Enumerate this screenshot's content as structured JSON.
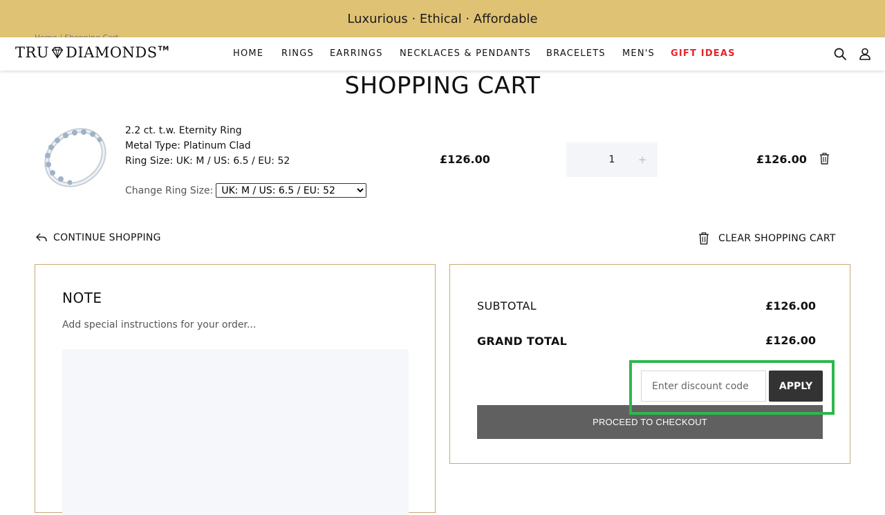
{
  "promo": {
    "text": "Luxurious · Ethical · Affordable"
  },
  "breadcrumb_ghost": "Home / Shopping Cart",
  "header": {
    "logo_left": "TRU",
    "logo_right": "DIAMONDS",
    "logo_tm": "TM",
    "nav": [
      "HOME",
      "RINGS",
      "EARRINGS",
      "NECKLACES & PENDANTS",
      "BRACELETS",
      "MEN'S",
      "GIFT IDEAS"
    ],
    "nav_accent_index": 6,
    "icons": [
      "search-icon",
      "user-icon"
    ]
  },
  "page_title": "SHOPPING CART",
  "cart_item": {
    "image_icon": "eternity-ring-image",
    "name": "2.2 ct. t.w. Eternity Ring",
    "metal": "Metal Type: Platinum Clad",
    "ring_size": "Ring Size: UK: M / US: 6.5 / EU: 52",
    "change_size_label": "Change Ring Size:",
    "change_size_selected": "UK: M / US: 6.5 / EU: 52",
    "unit_price": "£126.00",
    "quantity": "1",
    "plus": "+",
    "line_total": "£126.00",
    "remove_icon": "trash-icon"
  },
  "actions": {
    "continue_shopping": "CONTINUE SHOPPING",
    "clear_cart": "CLEAR SHOPPING CART"
  },
  "note": {
    "title": "NOTE",
    "hint": "Add special instructions for your order..."
  },
  "summary": {
    "subtotal_label": "SUBTOTAL",
    "subtotal_value": "£126.00",
    "grand_total_label": "GRAND TOTAL",
    "grand_total_value": "£126.00",
    "discount_placeholder": "Enter discount code",
    "apply_label": "APPLY",
    "checkout_label": "PROCEED TO CHECKOUT"
  },
  "colors": {
    "promo_bg": "#e0c274",
    "accent_red": "#e8232a",
    "box_border": "#c8a874",
    "highlight_green": "#2db84d",
    "apply_bg": "#333333",
    "checkout_bg": "#606060"
  }
}
